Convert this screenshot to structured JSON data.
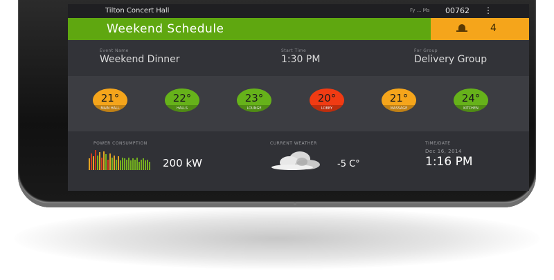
{
  "status_bar": {
    "venue": "Tilton Concert Hall",
    "user": "Fy ... Ms",
    "code": "00762",
    "menu_icon": "vertical-dots-icon"
  },
  "header": {
    "title": "Weekend Schedule",
    "alert_count": "4",
    "alert_icon": "bell-icon",
    "colors": {
      "header": "#5fa710",
      "alert": "#f5a51b"
    }
  },
  "event": {
    "name_label": "Event Name",
    "name": "Weekend Dinner",
    "time_label": "Start Time",
    "time": "1:30 PM",
    "group_label": "For Group",
    "group": "Delivery Group"
  },
  "rooms": [
    {
      "temp": "21°",
      "name": "MAIN HALL",
      "color": "#f5a51b"
    },
    {
      "temp": "22°",
      "name": "HALLS",
      "color": "#66b21a"
    },
    {
      "temp": "23°",
      "name": "LOUNGE",
      "color": "#66b21a"
    },
    {
      "temp": "20°",
      "name": "LOBBY",
      "color": "#f13b13"
    },
    {
      "temp": "21°",
      "name": "MASSAGE",
      "color": "#f5a51b"
    },
    {
      "temp": "24°",
      "name": "KITCHEN",
      "color": "#66b21a"
    }
  ],
  "power": {
    "label": "POWER CONSUMPTION",
    "value": "200 kW",
    "levels": [
      0.55,
      0.8,
      0.65,
      0.95,
      0.7,
      0.85,
      0.6,
      0.9,
      0.75,
      0.5,
      0.8,
      0.6,
      0.7,
      0.5,
      0.65,
      0.45,
      0.6,
      0.55,
      0.5,
      0.6,
      0.45,
      0.55,
      0.5,
      0.6,
      0.4,
      0.5,
      0.55,
      0.45,
      0.5,
      0.4
    ],
    "bar_colors": [
      "#e2a325",
      "#d23a1f",
      "#e2a325",
      "#c8341a",
      "#74b21e",
      "#e2a325",
      "#d23a1f",
      "#e2a325",
      "#74b21e",
      "#d23a1f",
      "#e2a325",
      "#74b21e",
      "#e2a325",
      "#74b21e",
      "#e2a325",
      "#74b21e",
      "#74b21e",
      "#74b21e",
      "#74b21e",
      "#74b21e",
      "#74b21e",
      "#74b21e",
      "#74b21e",
      "#74b21e",
      "#74b21e",
      "#74b21e",
      "#74b21e",
      "#74b21e",
      "#74b21e",
      "#74b21e"
    ]
  },
  "weather": {
    "label": "CURRENT WEATHER",
    "value": "-5 C°",
    "icon": "cloud-icon"
  },
  "datetime": {
    "label": "TIME/DATE",
    "date": "Dec 16, 2014",
    "time": "1:16 PM"
  }
}
